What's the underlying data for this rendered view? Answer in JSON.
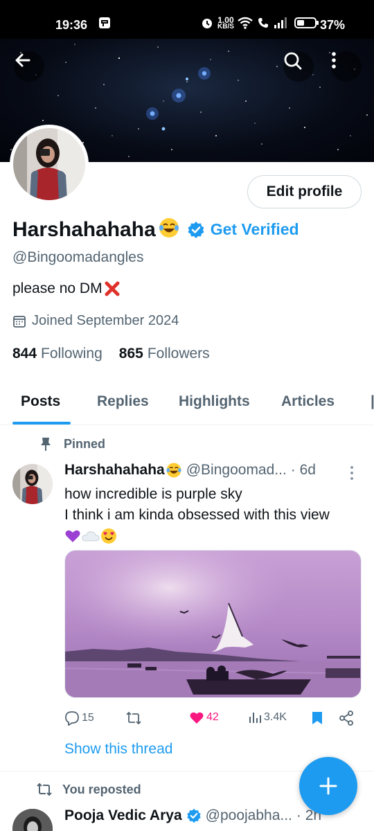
{
  "status_bar": {
    "time": "19:36",
    "net_speed_value": "1.00",
    "net_speed_unit": "KB/S",
    "battery": "37%"
  },
  "header": {
    "back_icon": "arrow-left-icon",
    "search_icon": "search-icon",
    "more_icon": "more-vertical-icon"
  },
  "profile": {
    "name": "Harshahahaha",
    "get_verified": "Get Verified",
    "handle": "@Bingoomadangles",
    "bio": "please no DM",
    "joined": "Joined September 2024",
    "following_count": "844",
    "following_label": "Following",
    "followers_count": "865",
    "followers_label": "Followers",
    "edit_profile": "Edit profile"
  },
  "tabs": [
    {
      "label": "Posts",
      "active": true
    },
    {
      "label": "Replies"
    },
    {
      "label": "Highlights"
    },
    {
      "label": "Articles"
    }
  ],
  "pinned_post": {
    "pinned_label": "Pinned",
    "author": "Harshahahaha",
    "handle": "@Bingoomad...",
    "time": "· 6d",
    "text_line1": "how incredible is purple sky",
    "text_line2": "I think i am kinda obsessed with this view",
    "replies": "15",
    "likes": "42",
    "views": "3.4K",
    "show_thread": "Show this thread"
  },
  "second_post": {
    "reposted_label": "You reposted",
    "author": "Pooja Vedic Arya",
    "handle": "@poojabha...",
    "time": "· 2h"
  },
  "colors": {
    "accent": "#1d9bf0",
    "like": "#f91880",
    "text": "#0f1419",
    "muted": "#536471"
  }
}
